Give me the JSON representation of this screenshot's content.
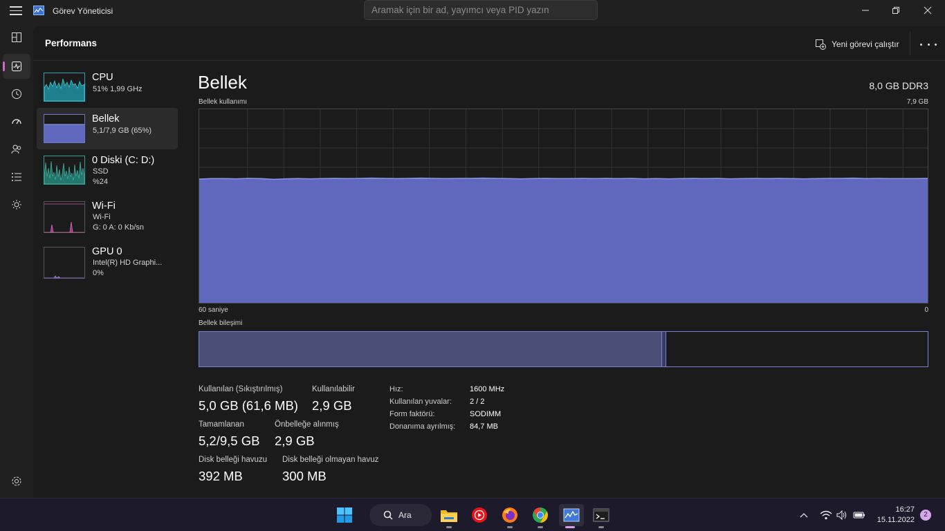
{
  "window": {
    "title": "Görev Yöneticisi",
    "search_placeholder": "Aramak için bir ad, yayımcı veya PID yazın"
  },
  "nav": {
    "icons": [
      "processes-icon",
      "performance-icon",
      "app-history-icon",
      "startup-apps-icon",
      "users-icon",
      "details-icon",
      "services-icon",
      "settings-icon"
    ],
    "active": "performance-icon",
    "accent": "#c86ac8"
  },
  "header": {
    "title": "Performans",
    "run_task_label": "Yeni görevi çalıştır"
  },
  "sidebar": {
    "items": [
      {
        "title": "CPU",
        "sub1": "51%  1,99 GHz",
        "sub2": "",
        "color": "#28a6b6",
        "selected": false
      },
      {
        "title": "Bellek",
        "sub1": "5,1/7,9 GB (65%)",
        "sub2": "",
        "color": "#6d74c9",
        "selected": true
      },
      {
        "title": "0 Diski (C: D:)",
        "sub1": "SSD",
        "sub2": "%24",
        "color": "#3a9d8e",
        "selected": false
      },
      {
        "title": "Wi-Fi",
        "sub1": "Wi-Fi",
        "sub2": "G: 0 A: 0 Kb/sn",
        "color": "#c85ca8",
        "selected": false
      },
      {
        "title": "GPU 0",
        "sub1": "Intel(R) HD Graphi...",
        "sub2": "0%",
        "color": "#8a6ac8",
        "selected": false
      }
    ]
  },
  "detail": {
    "title": "Bellek",
    "spec": "8,0 GB DDR3",
    "usage_label": "Bellek kullanımı",
    "usage_max": "7,9 GB",
    "time_left": "60 saniye",
    "time_right": "0",
    "composition_label": "Bellek bileşimi",
    "composition": {
      "in_use_fraction": 0.635,
      "modified_fraction": 0.006
    },
    "usage_color": "#5f68bd",
    "usage_line_color": "#8f96e8",
    "usage_history_gb": [
      5.05,
      5.07,
      5.07,
      5.06,
      5.08,
      5.07,
      5.04,
      5.06,
      5.07,
      5.06,
      5.07,
      5.08,
      5.07,
      5.08,
      5.09,
      5.08,
      5.07,
      5.08,
      5.09,
      5.08,
      5.07,
      5.08,
      5.08,
      5.09,
      5.08,
      5.07,
      5.06,
      5.07,
      5.08,
      5.07,
      5.07,
      5.08,
      5.07,
      5.08,
      5.07,
      5.08,
      5.06,
      5.07,
      5.06,
      5.07,
      5.08,
      5.07,
      5.08,
      5.06,
      5.07,
      5.08,
      5.07,
      5.08,
      5.07,
      5.06,
      5.07,
      5.08,
      5.08,
      5.09,
      5.07,
      5.08,
      5.07,
      5.07,
      5.07,
      5.08
    ],
    "usage_max_gb": 7.9,
    "stats": {
      "in_use_label": "Kullanılan (Sıkıştırılmış)",
      "in_use_value": "5,0 GB (61,6 MB)",
      "available_label": "Kullanılabilir",
      "available_value": "2,9 GB",
      "committed_label": "Tamamlanan",
      "committed_value": "5,2/9,5 GB",
      "cached_label": "Önbelleğe alınmış",
      "cached_value": "2,9 GB",
      "paged_label": "Disk belleği havuzu",
      "paged_value": "392 MB",
      "nonpaged_label": "Disk belleği olmayan havuz",
      "nonpaged_value": "300 MB"
    },
    "kv": [
      {
        "key": "Hız:",
        "value": "1600 MHz"
      },
      {
        "key": "Kullanılan yuvalar:",
        "value": "2 / 2"
      },
      {
        "key": "Form faktörü:",
        "value": "SODIMM"
      },
      {
        "key": "Donanıma ayrılmış:",
        "value": "84,7 MB"
      }
    ]
  },
  "taskbar": {
    "search_label": "Ara",
    "apps": [
      "start-icon",
      "file-explorer-icon",
      "youtube-music-icon",
      "firefox-icon",
      "chrome-icon",
      "task-manager-icon",
      "terminal-icon"
    ],
    "time": "16:27",
    "date": "15.11.2022",
    "notification_count": "2"
  }
}
